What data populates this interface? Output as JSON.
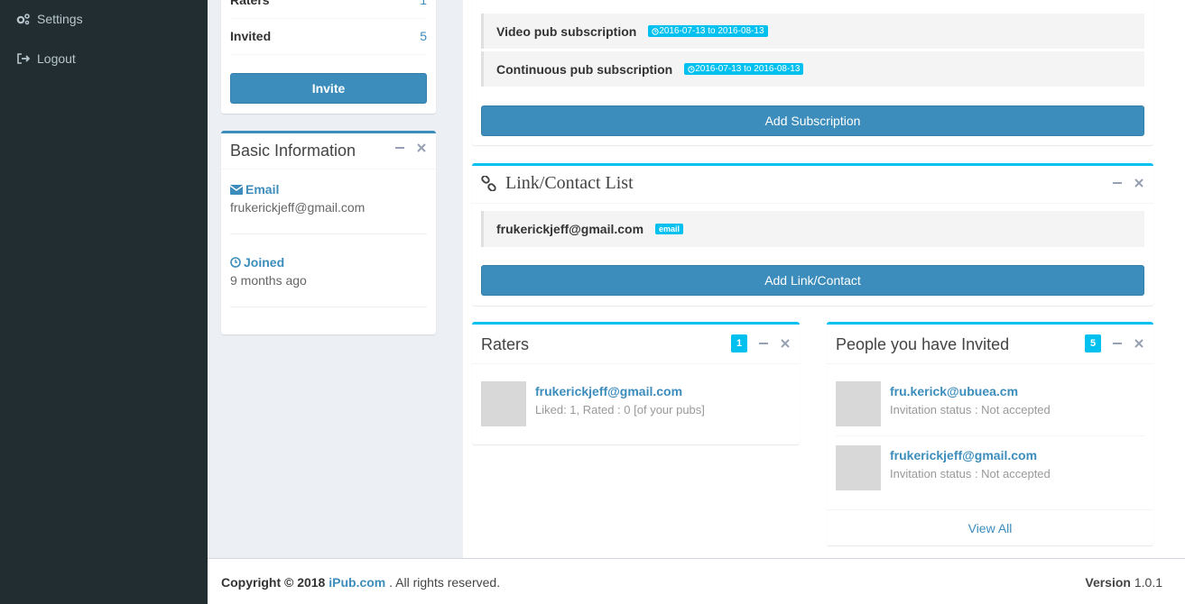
{
  "sidebar": {
    "items": [
      {
        "label": "Settings",
        "icon": "gears-icon"
      },
      {
        "label": "Logout",
        "icon": "sign-out-icon"
      }
    ]
  },
  "profile": {
    "raters_label": "Raters",
    "raters_count": "1",
    "invited_label": "Invited",
    "invited_count": "5",
    "invite_button": "Invite"
  },
  "basic_info": {
    "title": "Basic Information",
    "email_label": "Email",
    "email_value": "frukerickjeff@gmail.com",
    "joined_label": "Joined",
    "joined_value": "9 months ago"
  },
  "subscriptions": {
    "items": [
      {
        "name": "Video pub subscription",
        "dates": "2016-07-13 to 2016-08-13"
      },
      {
        "name": "Continuous pub subscription",
        "dates": "2016-07-13 to 2016-08-13"
      }
    ],
    "add_button": "Add Subscription"
  },
  "links": {
    "title": "Link/Contact List",
    "items": [
      {
        "value": "frukerickjeff@gmail.com",
        "type": "email"
      }
    ],
    "add_button": "Add Link/Contact"
  },
  "raters": {
    "title": "Raters",
    "count": "1",
    "items": [
      {
        "name": "frukerickjeff@gmail.com",
        "detail": "Liked: 1, Rated : 0 [of your pubs]"
      }
    ]
  },
  "invited": {
    "title": "People you have Invited",
    "count": "5",
    "items": [
      {
        "name": "fru.kerick@ubuea.cm",
        "status": "Invitation status : Not accepted"
      },
      {
        "name": "frukerickjeff@gmail.com",
        "status": "Invitation status : Not accepted"
      }
    ],
    "view_all": "View All"
  },
  "footer": {
    "copyright": "Copyright © 2018",
    "site": "iPub.com",
    "rights": ". All rights reserved.",
    "version_label": "Version",
    "version": "1.0.1"
  },
  "colors": {
    "sidebar_bg": "#222d32",
    "primary": "#3c8dbc",
    "info": "#00c0ef"
  }
}
